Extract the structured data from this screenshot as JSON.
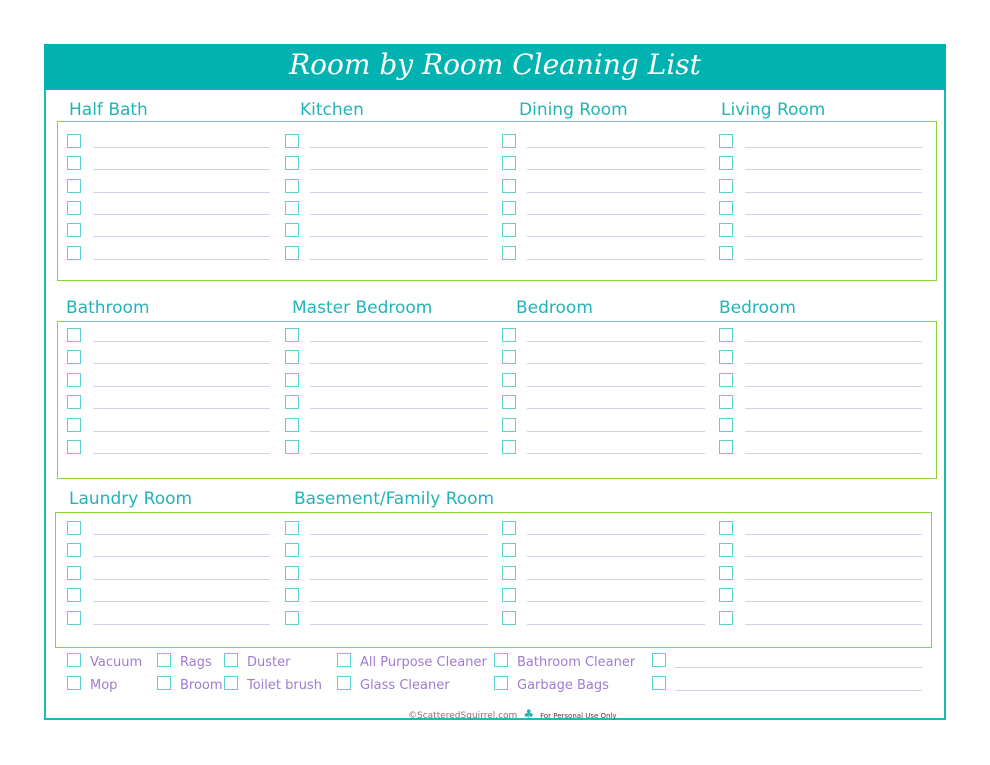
{
  "title": "Room by Room Cleaning List",
  "sections": [
    {
      "rows": 6,
      "headings": [
        "Half Bath",
        "Kitchen",
        "Dining Room",
        "Living Room"
      ]
    },
    {
      "rows": 6,
      "headings": [
        "Bathroom",
        "Master Bedroom",
        "Bedroom",
        "Bedroom"
      ]
    },
    {
      "rows": 5,
      "headings": [
        "Laundry Room",
        "Basement/Family Room",
        "",
        ""
      ]
    }
  ],
  "supplies": [
    [
      "Vacuum",
      "Rags",
      "Duster",
      "All Purpose Cleaner",
      "Bathroom Cleaner",
      ""
    ],
    [
      "Mop",
      "Broom",
      "Toilet brush",
      "Glass Cleaner",
      "Garbage Bags",
      ""
    ]
  ],
  "footer": {
    "site": "©ScatteredSquirrel.com",
    "logo_icon": "squirrel-icon",
    "note": "For Personal Use Only"
  },
  "colors": {
    "header": "#00b2b0",
    "heading": "#22b4b6",
    "box_border": "#86d33f",
    "checkbox": "#5ccfcf",
    "line": "#d9cdee",
    "supply_text": "#a07bd0"
  }
}
